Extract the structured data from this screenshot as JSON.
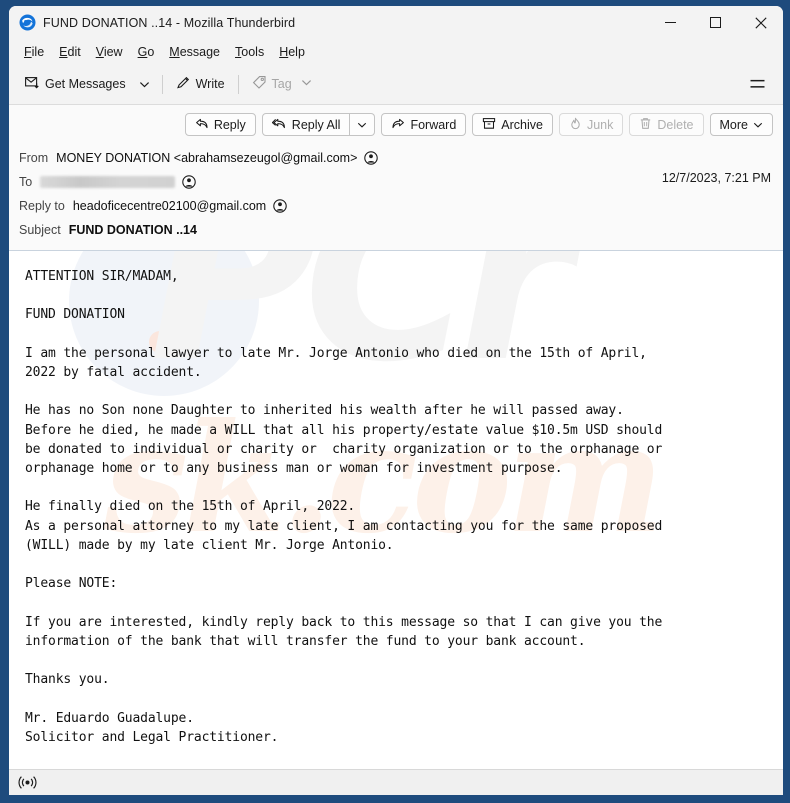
{
  "window": {
    "title": "FUND DONATION ..14 - Mozilla Thunderbird",
    "app_icon": "thunderbird-logo-icon",
    "controls": {
      "minimize": "minimize-icon",
      "maximize": "maximize-icon",
      "close": "close-icon"
    },
    "accent_color": "#1e4b7d",
    "titlebar_color": "#f3f3f3"
  },
  "menubar": {
    "items": [
      {
        "label": "File",
        "accesskey": "F"
      },
      {
        "label": "Edit",
        "accesskey": "E"
      },
      {
        "label": "View",
        "accesskey": "V"
      },
      {
        "label": "Go",
        "accesskey": "G"
      },
      {
        "label": "Message",
        "accesskey": "M"
      },
      {
        "label": "Tools",
        "accesskey": "T"
      },
      {
        "label": "Help",
        "accesskey": "H"
      }
    ]
  },
  "toolbar": {
    "get_messages_label": "Get Messages",
    "get_messages_icon": "get-messages-icon",
    "get_messages_chevron": "chevron-down-icon",
    "write_label": "Write",
    "write_icon": "pencil-icon",
    "tag_label": "Tag",
    "tag_icon": "tag-icon",
    "tag_chevron": "chevron-down-icon",
    "tag_disabled": true,
    "app_menu_icon": "hamburger-menu-icon"
  },
  "message_actions": {
    "reply_label": "Reply",
    "reply_icon": "reply-arrow-icon",
    "reply_all_label": "Reply All",
    "reply_all_icon": "reply-all-arrow-icon",
    "reply_all_chevron": "chevron-down-icon",
    "forward_label": "Forward",
    "forward_icon": "forward-arrow-icon",
    "archive_label": "Archive",
    "archive_icon": "archive-box-icon",
    "junk_label": "Junk",
    "junk_icon": "junk-flame-icon",
    "junk_disabled": true,
    "delete_label": "Delete",
    "delete_icon": "trash-icon",
    "delete_disabled": true,
    "more_label": "More",
    "more_chevron": "chevron-down-icon"
  },
  "message_header": {
    "from_label": "From",
    "from_value": "MONEY DONATION <abrahamsezeugol@gmail.com>",
    "to_label": "To",
    "to_value": "",
    "to_redacted": true,
    "reply_to_label": "Reply to",
    "reply_to_value": "headoficecentre02100@gmail.com",
    "subject_label": "Subject",
    "subject_value": "FUND DONATION ..14",
    "timestamp": "12/7/2023, 7:21 PM",
    "contact_icon": "contact-avatar-icon"
  },
  "message_body": {
    "text": "ATTENTION SIR/MADAM,\n\nFUND DONATION\n\nI am the personal lawyer to late Mr. Jorge Antonio who died on the 15th of April,\n2022 by fatal accident.\n\nHe has no Son none Daughter to inherited his wealth after he will passed away.\nBefore he died, he made a WILL that all his property/estate value $10.5m USD should\nbe donated to individual or charity or  charity organization or to the orphanage or\norphanage home or to any business man or woman for investment purpose.\n\nHe finally died on the 15th of April, 2022.\nAs a personal attorney to my late client, I am contacting you for the same proposed\n(WILL) made by my late client Mr. Jorge Antonio.\n\nPlease NOTE:\n\nIf you are interested, kindly reply back to this message so that I can give you the\ninformation of the bank that will transfer the fund to your bank account.\n\nThanks you.\n\nMr. Eduardo Guadalupe.\nSolicitor and Legal Practitioner.",
    "watermark_primary": "PCr",
    "watermark_secondary": "sk.com"
  },
  "statusbar": {
    "connection_icon": "broadcast-signal-icon"
  }
}
